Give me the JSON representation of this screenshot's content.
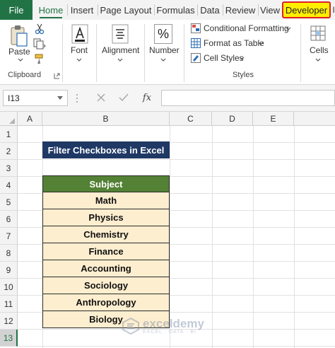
{
  "tabs": {
    "file": "File",
    "home": "Home",
    "insert": "Insert",
    "page_layout": "Page Layout",
    "formulas": "Formulas",
    "data": "Data",
    "review": "Review",
    "view": "View",
    "developer": "Developer"
  },
  "ribbon": {
    "clipboard": {
      "paste": "Paste",
      "group": "Clipboard"
    },
    "font": {
      "label": "Font"
    },
    "alignment": {
      "label": "Alignment"
    },
    "number": {
      "label": "Number",
      "icon_glyph": "%"
    },
    "styles": {
      "conditional": "Conditional Formatting",
      "format_table": "Format as Table",
      "cell_styles": "Cell Styles",
      "group": "Styles"
    },
    "cells": {
      "label": "Cells"
    }
  },
  "formula_bar": {
    "name_box": "I13",
    "fx": "fx"
  },
  "columns": [
    "A",
    "B",
    "C",
    "D",
    "E"
  ],
  "rows": [
    "1",
    "2",
    "3",
    "4",
    "5",
    "6",
    "7",
    "8",
    "9",
    "10",
    "11",
    "12",
    "13"
  ],
  "sheet": {
    "title": "Filter Checkboxes in Excel",
    "header": "Subject",
    "subjects": [
      "Math",
      "Physics",
      "Chemistry",
      "Finance",
      "Accounting",
      "Sociology",
      "Anthropology",
      "Biology"
    ]
  },
  "watermark": {
    "name": "exceldemy",
    "sub": "EXCEL · DATA · BI"
  },
  "colors": {
    "excel_green": "#217346",
    "title_fill": "#1f3864",
    "header_fill": "#538135",
    "data_fill": "#fdeecf",
    "developer_highlight": "#ffee00",
    "developer_border": "#e0202a"
  }
}
